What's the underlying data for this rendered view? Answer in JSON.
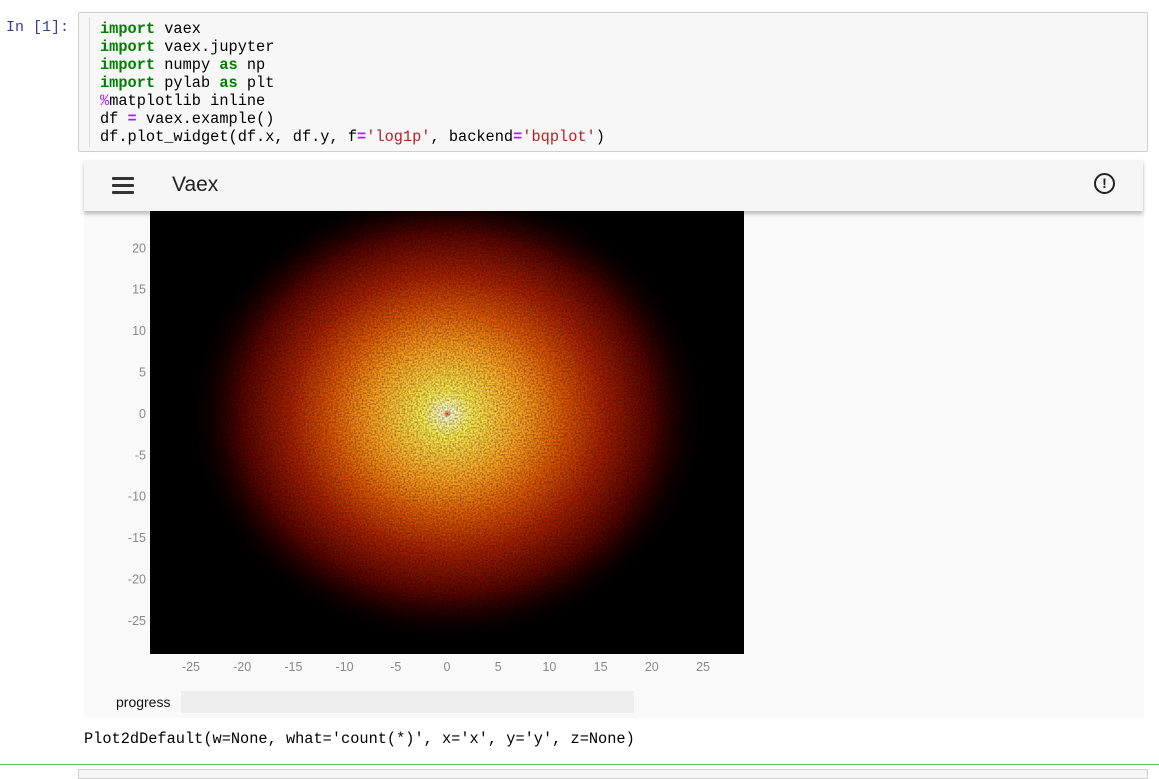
{
  "cell": {
    "prompt": "In [1]:",
    "code_lines": [
      [
        {
          "t": "import",
          "c": "kw"
        },
        {
          "t": " vaex"
        }
      ],
      [
        {
          "t": "import",
          "c": "kw"
        },
        {
          "t": " vaex.jupyter"
        }
      ],
      [
        {
          "t": "import",
          "c": "kw"
        },
        {
          "t": " numpy "
        },
        {
          "t": "as",
          "c": "kw"
        },
        {
          "t": " np"
        }
      ],
      [
        {
          "t": "import",
          "c": "kw"
        },
        {
          "t": " pylab "
        },
        {
          "t": "as",
          "c": "kw"
        },
        {
          "t": " plt"
        }
      ],
      [
        {
          "t": "%",
          "c": "mg"
        },
        {
          "t": "matplotlib inline"
        }
      ],
      [
        {
          "t": "df "
        },
        {
          "t": "=",
          "c": "op"
        },
        {
          "t": " vaex.example()"
        }
      ],
      [
        {
          "t": "df.plot_widget(df.x, df.y, f"
        },
        {
          "t": "=",
          "c": "op"
        },
        {
          "t": "'log1p'",
          "c": "str"
        },
        {
          "t": ", backend"
        },
        {
          "t": "=",
          "c": "op"
        },
        {
          "t": "'bqplot'",
          "c": "str"
        },
        {
          "t": ")"
        }
      ]
    ]
  },
  "widget": {
    "app_title": "Vaex",
    "menu_icon": "hamburger-menu-icon",
    "info_icon": "info-circle-icon",
    "info_symbol": "!",
    "progress_label": "progress",
    "progress_value": 0,
    "colors": {
      "accent": "#2196f3",
      "toolbar_bg": "#f5f5f5",
      "heatmap_colormap": [
        "#000000",
        "#4a0000",
        "#9b1a00",
        "#e05000",
        "#ff9a10",
        "#ffe040",
        "#ffffc0"
      ]
    }
  },
  "chart_data": {
    "type": "heatmap",
    "title": "",
    "xlabel": "",
    "ylabel": "",
    "xlim": [
      -29,
      29
    ],
    "ylim": [
      -29,
      24.5
    ],
    "x_ticks": [
      -25,
      -20,
      -15,
      -10,
      -5,
      0,
      5,
      10,
      15,
      20,
      25
    ],
    "y_ticks": [
      20,
      15,
      10,
      5,
      0,
      -5,
      -10,
      -15,
      -20,
      -25
    ],
    "function": "log1p",
    "what": "count(*)",
    "peak_xy": [
      0,
      0
    ],
    "grid": false
  },
  "output": {
    "text": "Plot2dDefault(w=None, what='count(*)', x='x', y='y', z=None)"
  }
}
